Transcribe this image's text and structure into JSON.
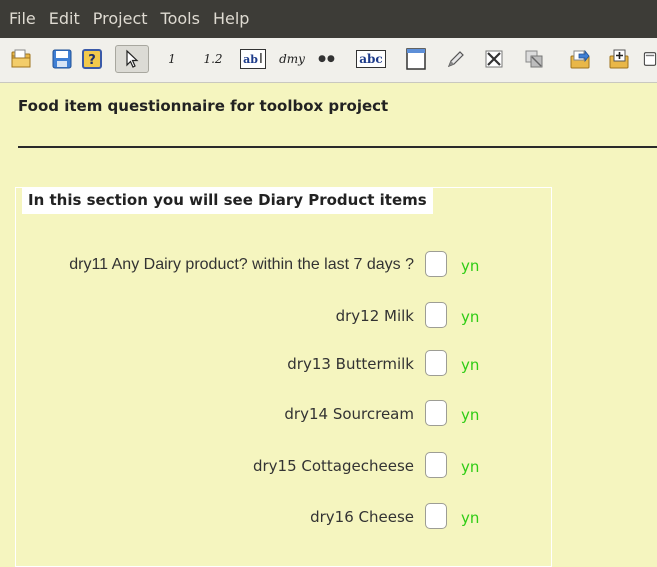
{
  "menubar": {
    "items": [
      "File",
      "Edit",
      "Project",
      "Tools",
      "Help"
    ]
  },
  "toolbar": {
    "buttons": [
      {
        "icon": "open-folder-icon"
      },
      {
        "icon": "save-icon"
      },
      {
        "icon": "help-icon"
      },
      {
        "icon": "pointer-icon"
      },
      {
        "icon": "integer-field-icon",
        "text": "1"
      },
      {
        "icon": "decimal-field-icon",
        "text": "1.2"
      },
      {
        "icon": "text-field-icon",
        "text": "ab"
      },
      {
        "icon": "date-field-icon",
        "text": "dmy"
      },
      {
        "icon": "choice-field-icon",
        "text": "●●"
      },
      {
        "icon": "label-icon",
        "text": "abc"
      },
      {
        "icon": "box-icon"
      },
      {
        "icon": "pencil-icon"
      },
      {
        "icon": "delete-icon"
      },
      {
        "icon": "group-icon"
      },
      {
        "icon": "export-icon"
      },
      {
        "icon": "add-page-icon"
      },
      {
        "icon": "preview-icon"
      }
    ]
  },
  "form": {
    "title": "Food item questionnaire for toolbox project",
    "section_heading": "In this section you will see Diary Product items",
    "questions": [
      {
        "label": "dry11  Any Dairy product? within the last 7 days ?",
        "type": "yn"
      },
      {
        "label": "dry12  Milk",
        "type": "yn"
      },
      {
        "label": "dry13  Buttermilk",
        "type": "yn"
      },
      {
        "label": "dry14  Sourcream",
        "type": "yn"
      },
      {
        "label": "dry15  Cottagecheese",
        "type": "yn"
      },
      {
        "label": "dry16  Cheese",
        "type": "yn"
      }
    ]
  },
  "colors": {
    "canvas": "#f5f5bf",
    "menubar": "#3d3c37",
    "yn_text": "#2fcc14"
  }
}
